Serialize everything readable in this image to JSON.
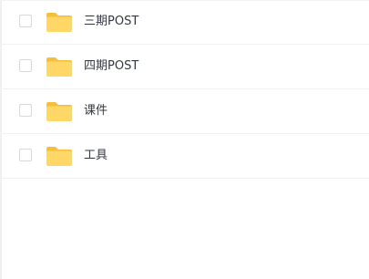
{
  "file_list": {
    "items": [
      {
        "name": "三期POST",
        "type": "folder",
        "icon": "folder-icon",
        "checked": false
      },
      {
        "name": "四期POST",
        "type": "folder",
        "icon": "folder-icon",
        "checked": false
      },
      {
        "name": "课件",
        "type": "folder",
        "icon": "folder-icon",
        "checked": false
      },
      {
        "name": "工具",
        "type": "folder",
        "icon": "folder-icon",
        "checked": false
      }
    ]
  },
  "colors": {
    "folder_body": "#FFD766",
    "folder_tab": "#F5BF3C",
    "text": "#333840",
    "divider": "#F0F1F3",
    "checkbox_border": "#D6D9DE"
  }
}
